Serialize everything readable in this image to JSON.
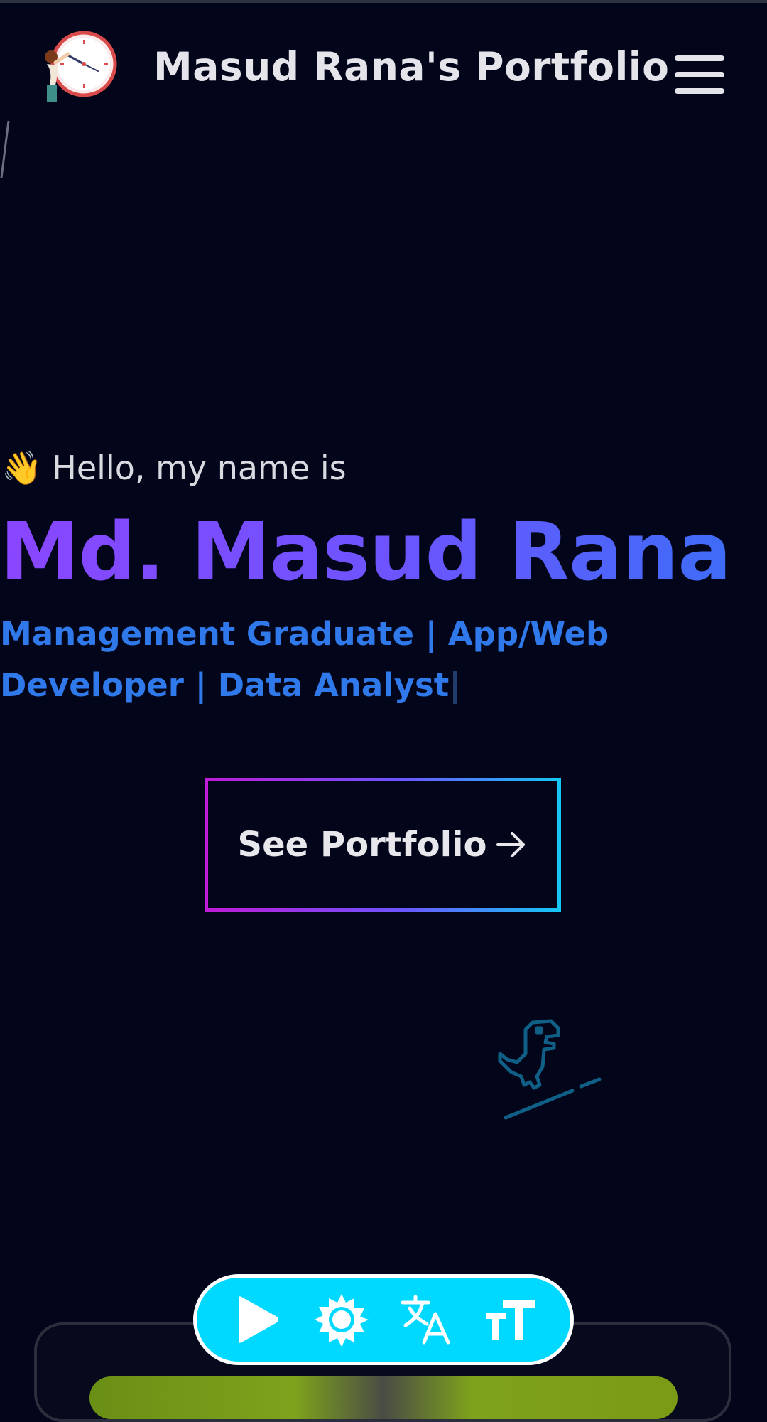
{
  "header": {
    "title": "Masud Rana's Portfolio",
    "logo_icon": "clock-girl-logo",
    "menu_icon": "hamburger-menu-icon"
  },
  "hero": {
    "greeting_emoji": "👋",
    "greeting": "Hello, my name is",
    "name": "Md. Masud Rana",
    "roles": "Management Graduate | App/Web Developer | Data Analyst",
    "cta_label": "See Portfolio"
  },
  "toolbar": {
    "items": [
      "play-icon",
      "sun-icon",
      "translate-icon",
      "text-size-icon"
    ]
  },
  "colors": {
    "background": "#03061a",
    "name_gradient_start": "#8a46ff",
    "name_gradient_end": "#3e6cf7",
    "roles": "#2f79ea",
    "toolbar": "#00d9ff"
  }
}
